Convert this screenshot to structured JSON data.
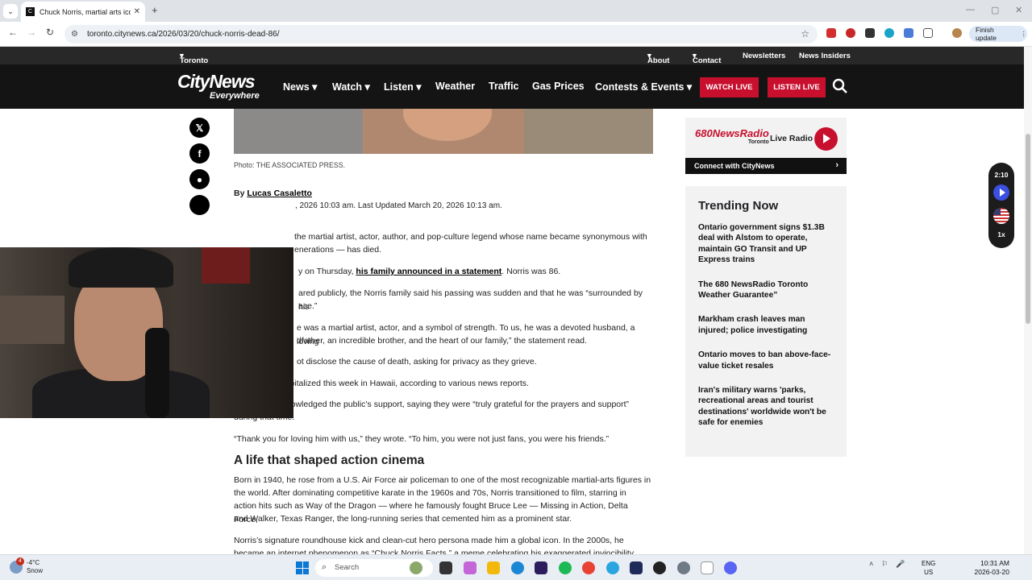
{
  "browser": {
    "tab_title": "Chuck Norris, martial arts icon a",
    "url": "toronto.citynews.ca/2026/03/20/chuck-norris-dead-86/",
    "finish_update": "Finish update"
  },
  "site": {
    "topbar": {
      "location": "Toronto",
      "about": "About",
      "contact": "Contact",
      "newsletters": "Newsletters",
      "news_insiders": "News Insiders"
    },
    "logo_line1": "CityNews",
    "logo_line2": "Everywhere",
    "nav": {
      "news": "News",
      "watch": "Watch",
      "listen": "Listen",
      "weather": "Weather",
      "traffic": "Traffic",
      "gas_prices": "Gas Prices",
      "contests": "Contests & Events",
      "watch_live": "WATCH LIVE",
      "listen_live": "LISTEN LIVE"
    }
  },
  "article": {
    "photo_caption": "Photo: THE ASSOCIATED PRESS.",
    "byline_prefix": "By",
    "author": "Lucas Casaletto",
    "timestamp": ", 2026 10:03 am.  Last Updated March 20, 2026 10:13 am.",
    "p1a": "the martial artist, actor, author, and pop-culture legend whose name became synonymous with",
    "p1b": "enerations — has died.",
    "p2_pre": "y on Thursday, ",
    "p2_link": "his family announced in a statement",
    "p2_post": ". Norris was 86.",
    "p3a": "ared publicly, the Norris family said his passing was sudden and that he was “surrounded by his",
    "p3b": "ace.”",
    "p4a": "e was a martial artist, actor, and a symbol of strength. To us, he was a devoted husband, a loving",
    "p4b": "dfather, an incredible brother, and the heart of our family,” the statement read.",
    "p5": "ot disclose the cause of death, asking for privacy as they grieve.",
    "p6": "Norris was hospitalized this week in Hawaii, according to various news reports.",
    "p7a": "His family acknowledged the public’s support, saying they were “truly grateful for the prayers and support”",
    "p7b": "during that time.",
    "p8": "“Thank you for loving him with us,” they wrote. “To him, you were not just fans, you were his friends.”",
    "h2": "A life that shaped action cinema",
    "p9a": "Born in 1940, he rose from a U.S. Air Force air policeman to one of the most recognizable martial-arts figures in",
    "p9b": "the world. After dominating competitive karate in the 1960s and 70s, Norris transitioned to film, starring in",
    "p9c": "action hits such as Way of the Dragon — where he famously fought Bruce Lee — Missing in Action, Delta Force,",
    "p9d": "and Walker, Texas Ranger, the long-running series that cemented him as a prominent star.",
    "p10a": "Norris’s signature roundhouse kick and clean-cut hero persona made him a global icon. In the 2000s, he",
    "p10b": "became an internet phenomenon as “Chuck Norris Facts,” a meme celebrating his exaggerated invincibility"
  },
  "sidebar": {
    "radio_logo": "680",
    "radio_logo_word": "NewsRadio",
    "radio_city": "Toronto",
    "live_radio": "Live Radio",
    "connect": "Connect with CityNews",
    "trending_title": "Trending Now",
    "trending": [
      "Ontario government signs $1.3B deal with Alstom to operate, maintain GO Transit and UP Express trains",
      "The 680 NewsRadio Toronto Weather Guarantee”",
      "Markham crash leaves man injured; police investigating",
      "Ontario moves to ban above-face-value ticket resales",
      "Iran's military warns 'parks, recreational areas and tourist destinations' worldwide won't be safe for enemies"
    ]
  },
  "player": {
    "time": "2:10",
    "speed": "1x"
  },
  "taskbar": {
    "weather_temp": "-4°C",
    "weather_desc": "Snow",
    "weather_badge": "4",
    "search_placeholder": "Search",
    "lang1": "ENG",
    "lang2": "US",
    "time": "10:31 AM",
    "date": "2026-03-20"
  },
  "colors": {
    "brand_red": "#c8102e",
    "nav_bg": "#141414",
    "accent_blue": "#3b4fe0"
  }
}
